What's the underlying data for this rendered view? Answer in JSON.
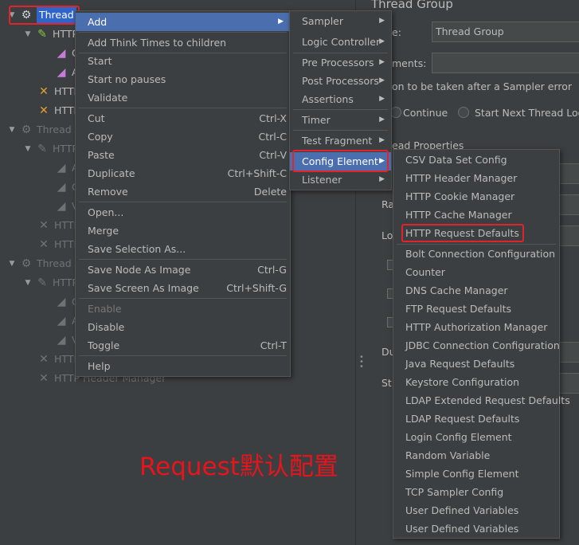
{
  "tree": {
    "rows": [
      {
        "label": "Thread",
        "icon": "gear-icon"
      },
      {
        "label": "HTTP",
        "icon": "pencil-icon"
      },
      {
        "label": "C",
        "icon": "chart-icon"
      },
      {
        "label": "A",
        "icon": "chart-icon"
      },
      {
        "label": "HTTP",
        "icon": "tool-icon"
      },
      {
        "label": "HTTP",
        "icon": "tool-icon"
      },
      {
        "label": "Thread",
        "icon": "gear-icon"
      },
      {
        "label": "HTTP",
        "icon": "pencil-icon"
      },
      {
        "label": "A",
        "icon": "chart-icon"
      },
      {
        "label": "C",
        "icon": "chart-icon"
      },
      {
        "label": "V",
        "icon": "chart-icon"
      },
      {
        "label": "HTTP",
        "icon": "tool-icon"
      },
      {
        "label": "HTTP",
        "icon": "tool-icon"
      },
      {
        "label": "Thread",
        "icon": "gear-icon"
      },
      {
        "label": "HTTP",
        "icon": "pencil-icon"
      },
      {
        "label": "C",
        "icon": "chart-icon"
      },
      {
        "label": "A",
        "icon": "chart-icon"
      },
      {
        "label": "V",
        "icon": "chart-icon"
      },
      {
        "label": "HTTP",
        "icon": "tool-icon"
      },
      {
        "label": "HTTP Header Manager",
        "icon": "tool-icon"
      }
    ]
  },
  "right_panel": {
    "title": "Thread Group",
    "name_label": "e:",
    "name_value": "Thread Group",
    "comments_label": "ments:",
    "action_heading": "on to be taken after a Sampler error",
    "radio_continue": "Continue",
    "radio_next_loop": "Start Next Thread Loop",
    "properties_heading": "ead Properties",
    "ra_label": "Ra",
    "lo_label": "Lo",
    "du_label": "Du",
    "st_label": "St"
  },
  "context_menu": {
    "items": [
      {
        "label": "Add",
        "shortcut": "",
        "submenu": true,
        "highlighted": true
      },
      {
        "label": "Add Think Times to children",
        "shortcut": ""
      },
      {
        "label": "Start",
        "shortcut": ""
      },
      {
        "label": "Start no pauses",
        "shortcut": ""
      },
      {
        "label": "Validate",
        "shortcut": ""
      },
      {
        "label": "Cut",
        "shortcut": "Ctrl-X"
      },
      {
        "label": "Copy",
        "shortcut": "Ctrl-C"
      },
      {
        "label": "Paste",
        "shortcut": "Ctrl-V"
      },
      {
        "label": "Duplicate",
        "shortcut": "Ctrl+Shift-C"
      },
      {
        "label": "Remove",
        "shortcut": "Delete"
      },
      {
        "label": "Open...",
        "shortcut": ""
      },
      {
        "label": "Merge",
        "shortcut": ""
      },
      {
        "label": "Save Selection As...",
        "shortcut": ""
      },
      {
        "label": "Save Node As Image",
        "shortcut": "Ctrl-G"
      },
      {
        "label": "Save Screen As Image",
        "shortcut": "Ctrl+Shift-G"
      },
      {
        "label": "Enable",
        "shortcut": "",
        "disabled": true
      },
      {
        "label": "Disable",
        "shortcut": ""
      },
      {
        "label": "Toggle",
        "shortcut": "Ctrl-T"
      },
      {
        "label": "Help",
        "shortcut": ""
      }
    ]
  },
  "add_menu": {
    "items": [
      {
        "label": "Sampler"
      },
      {
        "label": "Logic Controller"
      },
      {
        "label": "Pre Processors"
      },
      {
        "label": "Post Processors"
      },
      {
        "label": "Assertions"
      },
      {
        "label": "Timer"
      },
      {
        "label": "Test Fragment"
      },
      {
        "label": "Config Element",
        "highlighted": true
      },
      {
        "label": "Listener"
      }
    ]
  },
  "config_menu": {
    "items": [
      "CSV Data Set Config",
      "HTTP Header Manager",
      "HTTP Cookie Manager",
      "HTTP Cache Manager",
      "HTTP Request Defaults",
      "Bolt Connection Configuration",
      "Counter",
      "DNS Cache Manager",
      "FTP Request Defaults",
      "HTTP Authorization Manager",
      "JDBC Connection Configuration",
      "Java Request Defaults",
      "Keystore Configuration",
      "LDAP Extended Request Defaults",
      "LDAP Request Defaults",
      "Login Config Element",
      "Random Variable",
      "Simple Config Element",
      "TCP Sampler Config",
      "User Defined Variables",
      "User Defined Variables"
    ]
  },
  "annotation_text": "Request默认配置",
  "colors": {
    "accent": "#4b6eaf",
    "highlight_box": "#e0242a",
    "annotation": "#e8141b",
    "background": "#3c3f41"
  }
}
